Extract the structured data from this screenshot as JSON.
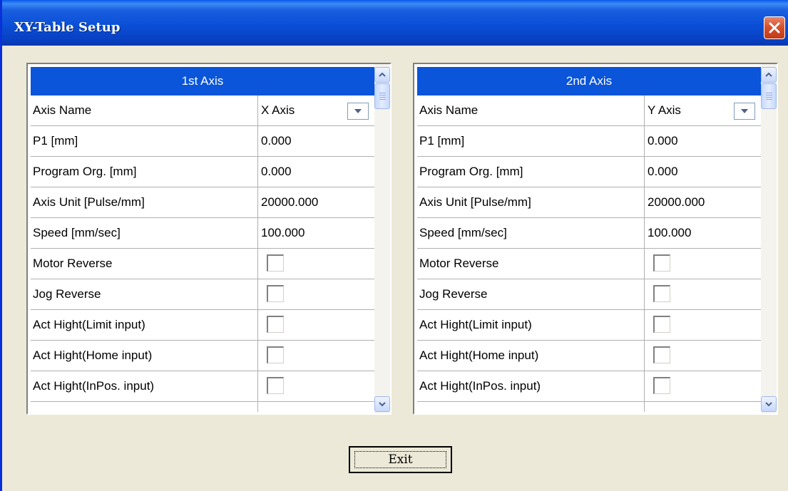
{
  "window": {
    "title": "XY-Table Setup",
    "colors": {
      "titlebar": "#0a4fd6",
      "header": "#0a55d9",
      "background": "#ece9d8",
      "close": "#d8512e"
    }
  },
  "icons": {
    "close": "close-x-icon",
    "dropdown": "chevron-down-icon",
    "scroll_up": "chevron-up-icon",
    "scroll_down": "chevron-down-icon"
  },
  "axis1": {
    "header": "1st Axis",
    "rows": [
      {
        "label": "Axis Name",
        "type": "select",
        "value": "X Axis"
      },
      {
        "label": "P1 [mm]",
        "type": "text",
        "value": "0.000"
      },
      {
        "label": "Program Org. [mm]",
        "type": "text",
        "value": "0.000"
      },
      {
        "label": "Axis Unit [Pulse/mm]",
        "type": "text",
        "value": "20000.000"
      },
      {
        "label": "Speed [mm/sec]",
        "type": "text",
        "value": "100.000"
      },
      {
        "label": "Motor Reverse",
        "type": "checkbox",
        "checked": false
      },
      {
        "label": "Jog Reverse",
        "type": "checkbox",
        "checked": false
      },
      {
        "label": "Act Hight(Limit input)",
        "type": "checkbox",
        "checked": false
      },
      {
        "label": "Act Hight(Home input)",
        "type": "checkbox",
        "checked": false
      },
      {
        "label": "Act Hight(InPos. input)",
        "type": "checkbox",
        "checked": false
      }
    ]
  },
  "axis2": {
    "header": "2nd Axis",
    "rows": [
      {
        "label": "Axis Name",
        "type": "select",
        "value": "Y Axis"
      },
      {
        "label": "P1 [mm]",
        "type": "text",
        "value": "0.000"
      },
      {
        "label": "Program Org. [mm]",
        "type": "text",
        "value": "0.000"
      },
      {
        "label": "Axis Unit [Pulse/mm]",
        "type": "text",
        "value": "20000.000"
      },
      {
        "label": "Speed [mm/sec]",
        "type": "text",
        "value": "100.000"
      },
      {
        "label": "Motor Reverse",
        "type": "checkbox",
        "checked": false
      },
      {
        "label": "Jog Reverse",
        "type": "checkbox",
        "checked": false
      },
      {
        "label": "Act Hight(Limit input)",
        "type": "checkbox",
        "checked": false
      },
      {
        "label": "Act Hight(Home input)",
        "type": "checkbox",
        "checked": false
      },
      {
        "label": "Act Hight(InPos. input)",
        "type": "checkbox",
        "checked": false
      }
    ]
  },
  "exit_label": "Exit"
}
